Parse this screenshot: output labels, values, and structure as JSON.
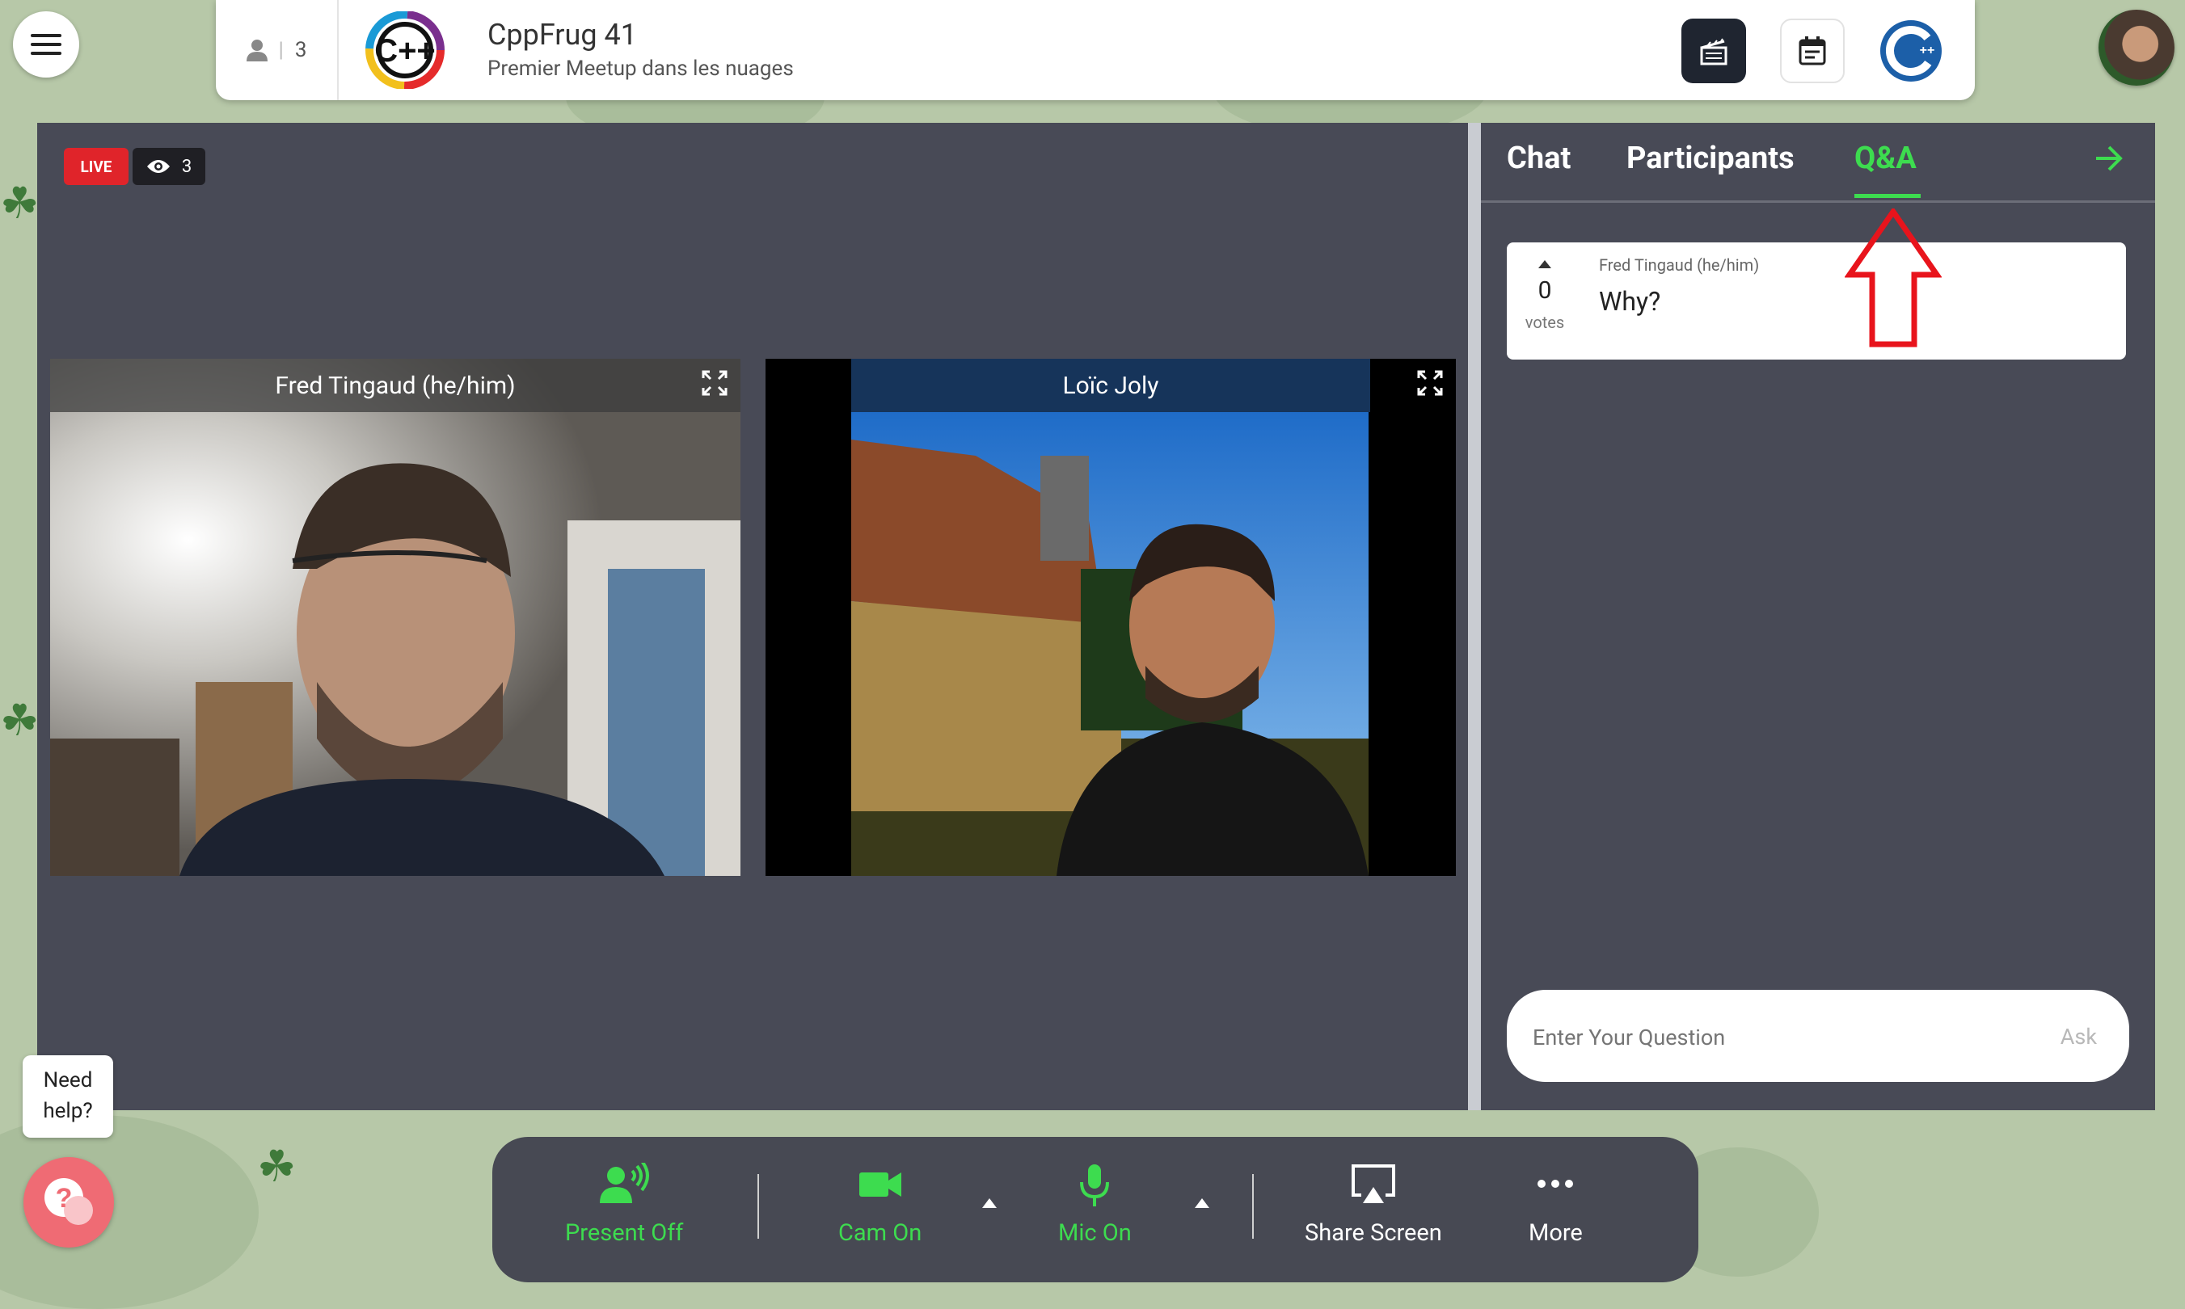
{
  "header": {
    "participant_count": "3",
    "title": "CppFrug 41",
    "subtitle": "Premier Meetup dans les nuages"
  },
  "stage": {
    "live_label": "LIVE",
    "viewer_count": "3",
    "tiles": [
      {
        "name": "Fred Tingaud (he/him)"
      },
      {
        "name": "Loïc Joly"
      }
    ]
  },
  "panel": {
    "tabs": [
      {
        "label": "Chat",
        "active": false
      },
      {
        "label": "Participants",
        "active": false
      },
      {
        "label": "Q&A",
        "active": true
      }
    ],
    "questions": [
      {
        "author": "Fred Tingaud (he/him)",
        "text": "Why?",
        "votes": "0",
        "votes_label": "votes"
      }
    ],
    "ask_placeholder": "Enter Your Question",
    "ask_button": "Ask"
  },
  "toolbar": {
    "present": "Present Off",
    "cam": "Cam On",
    "mic": "Mic On",
    "share": "Share Screen",
    "more": "More"
  },
  "help": {
    "line1": "Need",
    "line2": "help?"
  },
  "colors": {
    "accent_green": "#3ddc4f",
    "live_red": "#e0242a",
    "panel_bg": "#484a56"
  }
}
